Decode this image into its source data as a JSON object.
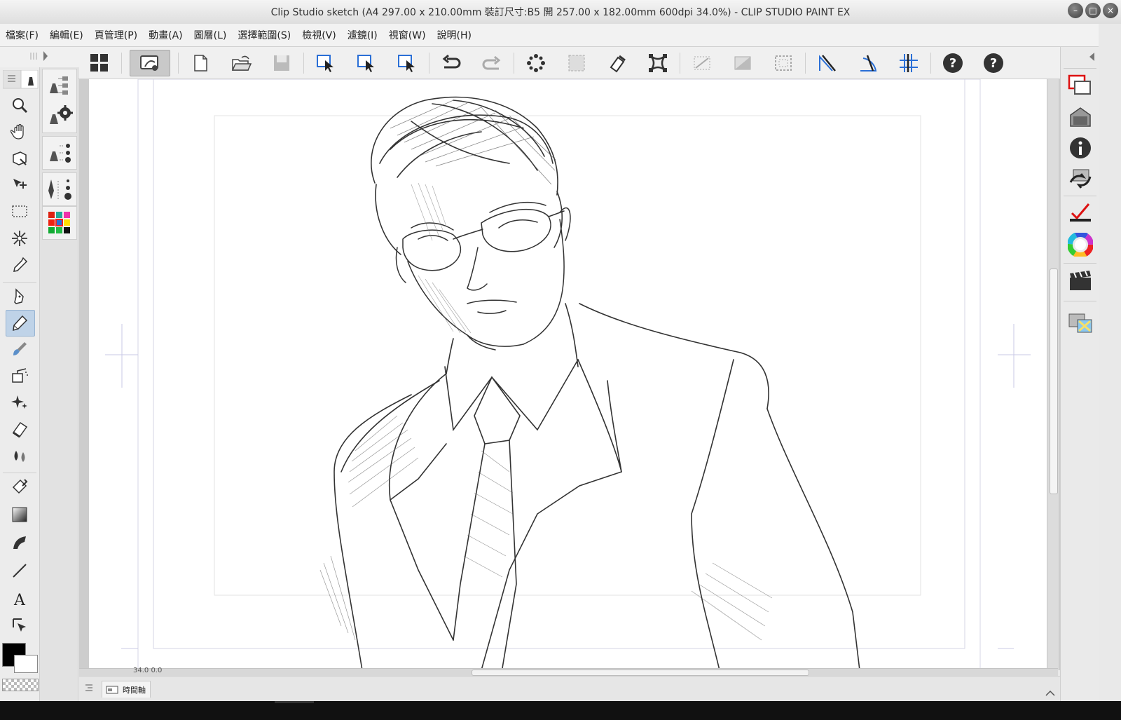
{
  "window": {
    "title": "Clip Studio sketch (A4 297.00 x 210.00mm 裝訂尺寸:B5 開 257.00 x 182.00mm 600dpi 34.0%)  - CLIP STUDIO PAINT EX",
    "controls": [
      "minimize-icon",
      "maximize-icon",
      "close-icon"
    ]
  },
  "menu": [
    {
      "label": "檔案(F)"
    },
    {
      "label": "編輯(E)"
    },
    {
      "label": "頁管理(P)"
    },
    {
      "label": "動畫(A)"
    },
    {
      "label": "圖層(L)"
    },
    {
      "label": "選擇範圍(S)"
    },
    {
      "label": "檢視(V)"
    },
    {
      "label": "濾鏡(I)"
    },
    {
      "label": "視窗(W)"
    },
    {
      "label": "說明(H)"
    }
  ],
  "toolbar": {
    "items": [
      "grid-menu-icon",
      "clip-studio-icon",
      "new-file-icon",
      "open-file-icon",
      "save-icon",
      "select-layer-icon",
      "select-layer-add-icon",
      "select-layer-remove-icon",
      "undo-icon",
      "redo-icon",
      "fill-dots-icon",
      "deselect-icon",
      "erase-selection-icon",
      "transform-icon",
      "show-selection-icon",
      "invert-selection-icon",
      "selection-border-icon",
      "ruler-snap-icon",
      "special-ruler-snap-icon",
      "grid-snap-icon",
      "help-icon",
      "help-2-icon"
    ]
  },
  "tools": [
    "zoom-icon",
    "hand-icon",
    "object-icon",
    "move-layer-icon",
    "rect-select-icon",
    "auto-select-icon",
    "eyedropper-icon",
    "pen-icon",
    "pencil-icon",
    "brush-icon",
    "airbrush-icon",
    "decoration-icon",
    "eraser-icon",
    "blend-icon",
    "fill-icon",
    "gradient-icon",
    "figure-icon",
    "line-icon",
    "text-icon",
    "operation-icon"
  ],
  "colors": {
    "main": "#000000",
    "sub": "#ffffff"
  },
  "status": {
    "zoom_readout": "34.0  0.0"
  },
  "timeline": {
    "tab_label": "時間軸"
  },
  "right_dock": [
    "layer-panel-icon",
    "material-icon",
    "property-icon",
    "navigator-icon",
    "color-history-icon",
    "color-wheel-icon",
    "animation-icon",
    "material-folder-icon"
  ]
}
